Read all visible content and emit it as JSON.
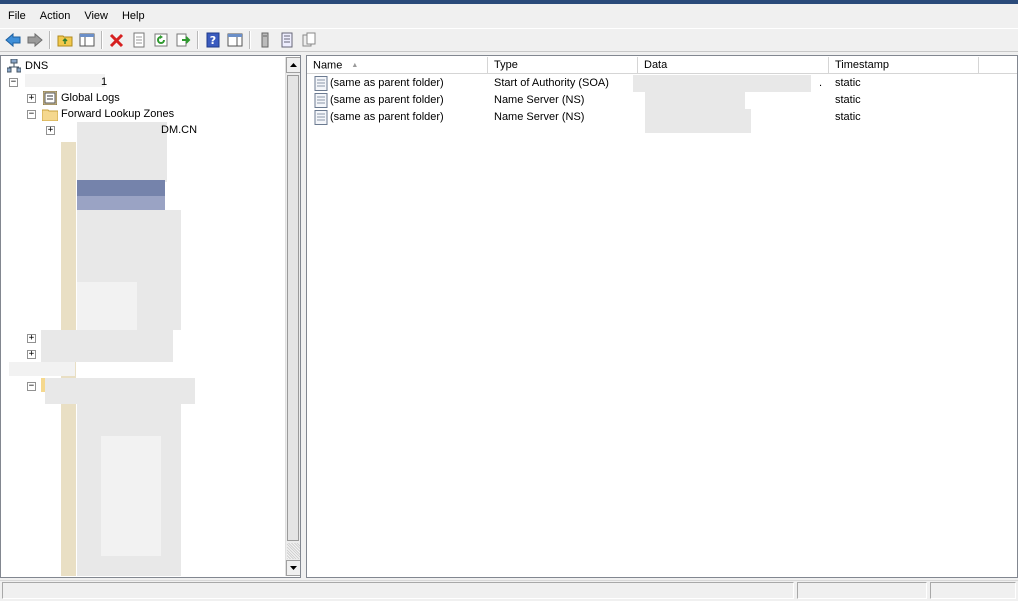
{
  "menu": [
    {
      "label": "File"
    },
    {
      "label": "Action"
    },
    {
      "label": "View"
    },
    {
      "label": "Help"
    }
  ],
  "tree": {
    "root": "DNS",
    "server_suffix": "1",
    "global_logs": "Global Logs",
    "forward_zones": "Forward Lookup Zones",
    "zone_suffix": "DM.CN",
    "expand_plus": "+",
    "expand_minus": "−"
  },
  "list": {
    "columns": [
      {
        "label": "Name"
      },
      {
        "label": "Type"
      },
      {
        "label": "Data"
      },
      {
        "label": "Timestamp"
      }
    ],
    "sort_arrow": "▲",
    "data_suffix": ".",
    "rows": [
      {
        "name": "(same as parent folder)",
        "type": "Start of Authority (SOA)",
        "timestamp": "static"
      },
      {
        "name": "(same as parent folder)",
        "type": "Name Server (NS)",
        "timestamp": "static"
      },
      {
        "name": "(same as parent folder)",
        "type": "Name Server (NS)",
        "timestamp": "static"
      }
    ]
  },
  "colors": {
    "accent": "#2a4a7a",
    "selection": "#7583ab"
  }
}
